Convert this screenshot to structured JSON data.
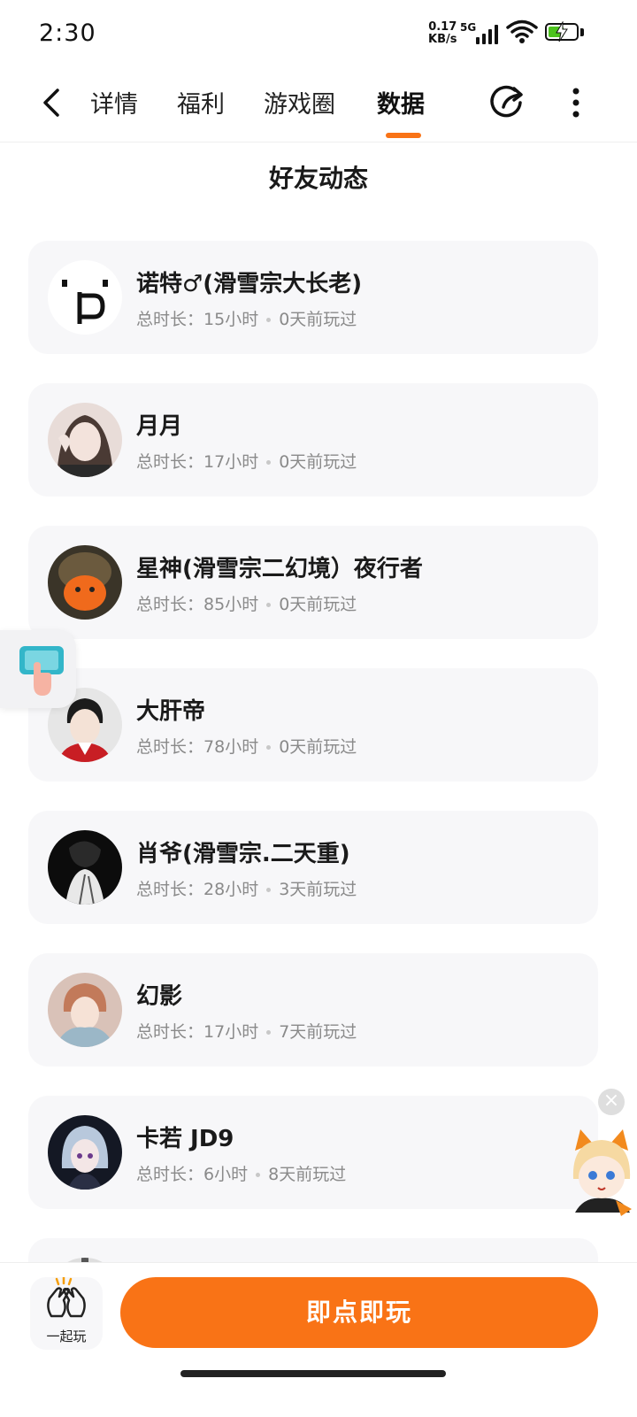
{
  "status_bar": {
    "time": "2:30",
    "net_speed_value": "0.17",
    "net_speed_unit": "KB/s",
    "network": "5G",
    "battery_level": 0.55
  },
  "nav": {
    "tabs": [
      {
        "label": "详情",
        "active": false
      },
      {
        "label": "福利",
        "active": false
      },
      {
        "label": "游戏圈",
        "active": false
      },
      {
        "label": "数据",
        "active": true
      }
    ]
  },
  "section": {
    "title": "好友动态"
  },
  "friends": [
    {
      "name": "诺特♂(滑雪宗大长老)",
      "total_label": "总时长：",
      "hours": "15小时",
      "last_played": "0天前玩过"
    },
    {
      "name": "月月",
      "total_label": "总时长：",
      "hours": "17小时",
      "last_played": "0天前玩过"
    },
    {
      "name": "星神(滑雪宗二幻境）夜行者",
      "total_label": "总时长：",
      "hours": "85小时",
      "last_played": "0天前玩过"
    },
    {
      "name": "大肝帝",
      "total_label": "总时长：",
      "hours": "78小时",
      "last_played": "0天前玩过"
    },
    {
      "name": "肖爷(滑雪宗.二天重)",
      "total_label": "总时长：",
      "hours": "28小时",
      "last_played": "3天前玩过"
    },
    {
      "name": "幻影",
      "total_label": "总时长：",
      "hours": "17小时",
      "last_played": "7天前玩过"
    },
    {
      "name": "卡若 JD9",
      "total_label": "总时长：",
      "hours": "6小时",
      "last_played": "8天前玩过"
    }
  ],
  "bottom": {
    "play_together_label": "一起玩",
    "play_now_label": "即点即玩"
  },
  "colors": {
    "accent": "#f97316",
    "card_bg": "#f7f7f9",
    "meta_text": "#8a8a8a"
  },
  "icons": {
    "back": "chevron-left-icon",
    "share": "share-arrow-icon",
    "more": "more-vertical-icon",
    "play_together": "clapping-hands-icon"
  }
}
